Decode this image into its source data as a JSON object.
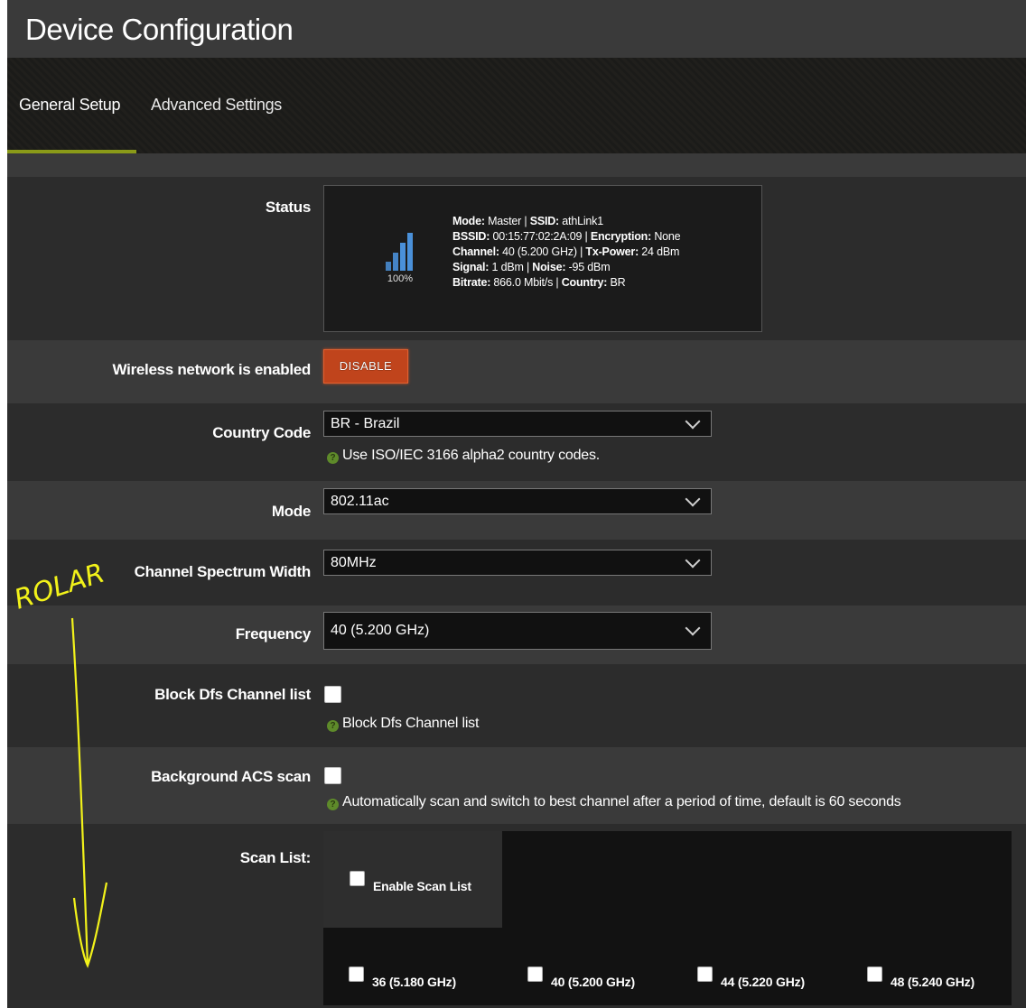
{
  "header": {
    "title": "Device Configuration"
  },
  "tabs": [
    {
      "label": "General Setup",
      "active": true
    },
    {
      "label": "Advanced Settings",
      "active": false
    }
  ],
  "status": {
    "label": "Status",
    "signal_percent": "100%",
    "signal_level": 1.0,
    "mode_key": "Mode:",
    "mode_value": " Master | ",
    "ssid_key": "SSID:",
    "ssid_value": " athLink1",
    "bssid_key": "BSSID:",
    "bssid_value": " 00:15:77:02:2A:09 | ",
    "enc_key": "Encryption:",
    "enc_value": " None",
    "channel_key": "Channel:",
    "channel_value": " 40 (5.200 GHz) | ",
    "txpower_key": "Tx-Power:",
    "txpower_value": " 24 dBm",
    "signal_key": "Signal:",
    "signal_value": " 1 dBm | ",
    "noise_key": "Noise:",
    "noise_value": " -95 dBm",
    "bitrate_key": "Bitrate:",
    "bitrate_value": " 866.0 Mbit/s | ",
    "country_key": "Country:",
    "country_value": " BR"
  },
  "wireless": {
    "label": "Wireless network is enabled",
    "button": "DISABLE"
  },
  "country_code": {
    "label": "Country Code",
    "value": "BR - Brazil",
    "help": "Use ISO/IEC 3166 alpha2 country codes."
  },
  "mode": {
    "label": "Mode",
    "value": "802.11ac"
  },
  "channel_width": {
    "label": "Channel Spectrum Width",
    "value": "80MHz"
  },
  "frequency": {
    "label": "Frequency",
    "value": "40 (5.200 GHz)"
  },
  "block_dfs": {
    "label": "Block Dfs Channel list",
    "help": "Block Dfs Channel list",
    "checked": false
  },
  "background_acs": {
    "label": "Background ACS scan",
    "help": "Automatically scan and switch to best channel after a period of time, default is 60 seconds",
    "checked": false
  },
  "scan_list": {
    "label": "Scan List:",
    "enable_label": "Enable Scan List",
    "channels": [
      {
        "label": "36 (5.180 GHz)",
        "checked": false
      },
      {
        "label": "40 (5.200 GHz)",
        "checked": false
      },
      {
        "label": "44 (5.220 GHz)",
        "checked": false
      },
      {
        "label": "48 (5.240 GHz)",
        "checked": false
      }
    ]
  },
  "annotation": {
    "text": "ROLAR",
    "color": "#f2f21a"
  },
  "colors": {
    "accent": "#8a9a18",
    "danger_button": "#c0441c",
    "signal_bars": "#4a90d9"
  }
}
